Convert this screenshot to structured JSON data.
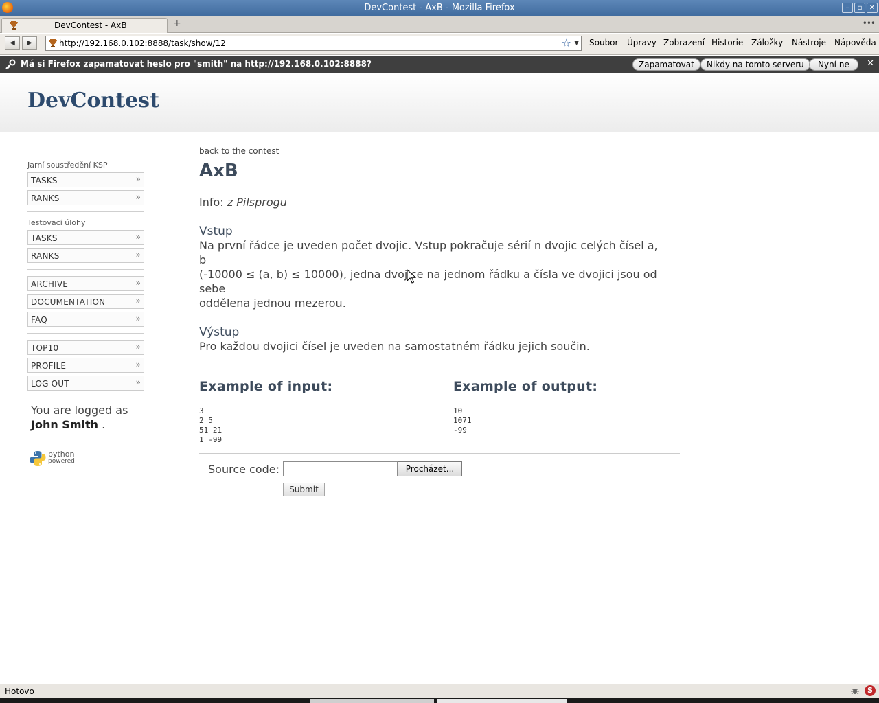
{
  "window": {
    "title": "DevContest - AxB - Mozilla Firefox",
    "buttons": [
      "–",
      "▫",
      "✕"
    ]
  },
  "tabs": [
    {
      "title": "DevContest - AxB",
      "active": true
    }
  ],
  "newtab_label": "+",
  "tabmenu_label": "•••",
  "navbar": {
    "url": "http://192.168.0.102:8888/task/show/12",
    "back_glyph": "◀",
    "forward_glyph": "▶",
    "star_icon": "☆",
    "dropdown_icon": "▼",
    "menu": [
      "Soubor",
      "Úpravy",
      "Zobrazení",
      "Historie",
      "Záložky",
      "Nástroje",
      "Nápověda"
    ]
  },
  "notification": {
    "message": "Má si Firefox zapamatovat heslo pro \"smith\" na http://192.168.0.102:8888?",
    "key_icon": "🔑",
    "buttons": [
      "Zapamatovat",
      "Nikdy na tomto serveru",
      "Nyní ne"
    ],
    "close_label": "✕"
  },
  "site": {
    "brand": "DevContest"
  },
  "sidebar": {
    "sections": [
      {
        "title": "Jarní soustředění KSP",
        "items": [
          "TASKS",
          "RANKS"
        ]
      },
      {
        "title": "Testovací úlohy",
        "items": [
          "TASKS",
          "RANKS"
        ]
      },
      {
        "title": "",
        "items": [
          "ARCHIVE",
          "DOCUMENTATION",
          "FAQ"
        ]
      },
      {
        "title": "",
        "items": [
          "TOP10",
          "PROFILE",
          "LOG OUT"
        ]
      }
    ],
    "chevron": "»",
    "logged_prefix": "You are logged as",
    "logged_user": "John Smith",
    "logged_suffix": ".",
    "python_badge": {
      "line1": "python",
      "line2": "powered"
    }
  },
  "task": {
    "back_link": "back to the contest",
    "title": "AxB",
    "info_label": "Info:",
    "info_value": "z Pilsprogu",
    "input_heading": "Vstup",
    "input_lines": [
      "Na první řádce je uveden počet dvojic. Vstup pokračuje sérií n dvojic celých čísel a,",
      "b",
      "(-10000 ≤ (a, b) ≤ 10000), jedna dvojice na jednom řádku a čísla ve dvojici jsou od",
      "sebe",
      "oddělena jednou mezerou."
    ],
    "output_heading": "Výstup",
    "output_text": "Pro každou dvojici čísel je uveden na samostatném řádku jejich součin.",
    "example_input_heading": "Example of input:",
    "example_output_heading": "Example of output:",
    "example_input": "3\n2 5\n51 21\n1 -99",
    "example_output": "10\n1071\n-99",
    "source_label": "Source code:",
    "browse_label": "Procházet...",
    "submit_label": "Submit"
  },
  "statusbar": {
    "text": "Hotovo",
    "icon_right": "S"
  }
}
